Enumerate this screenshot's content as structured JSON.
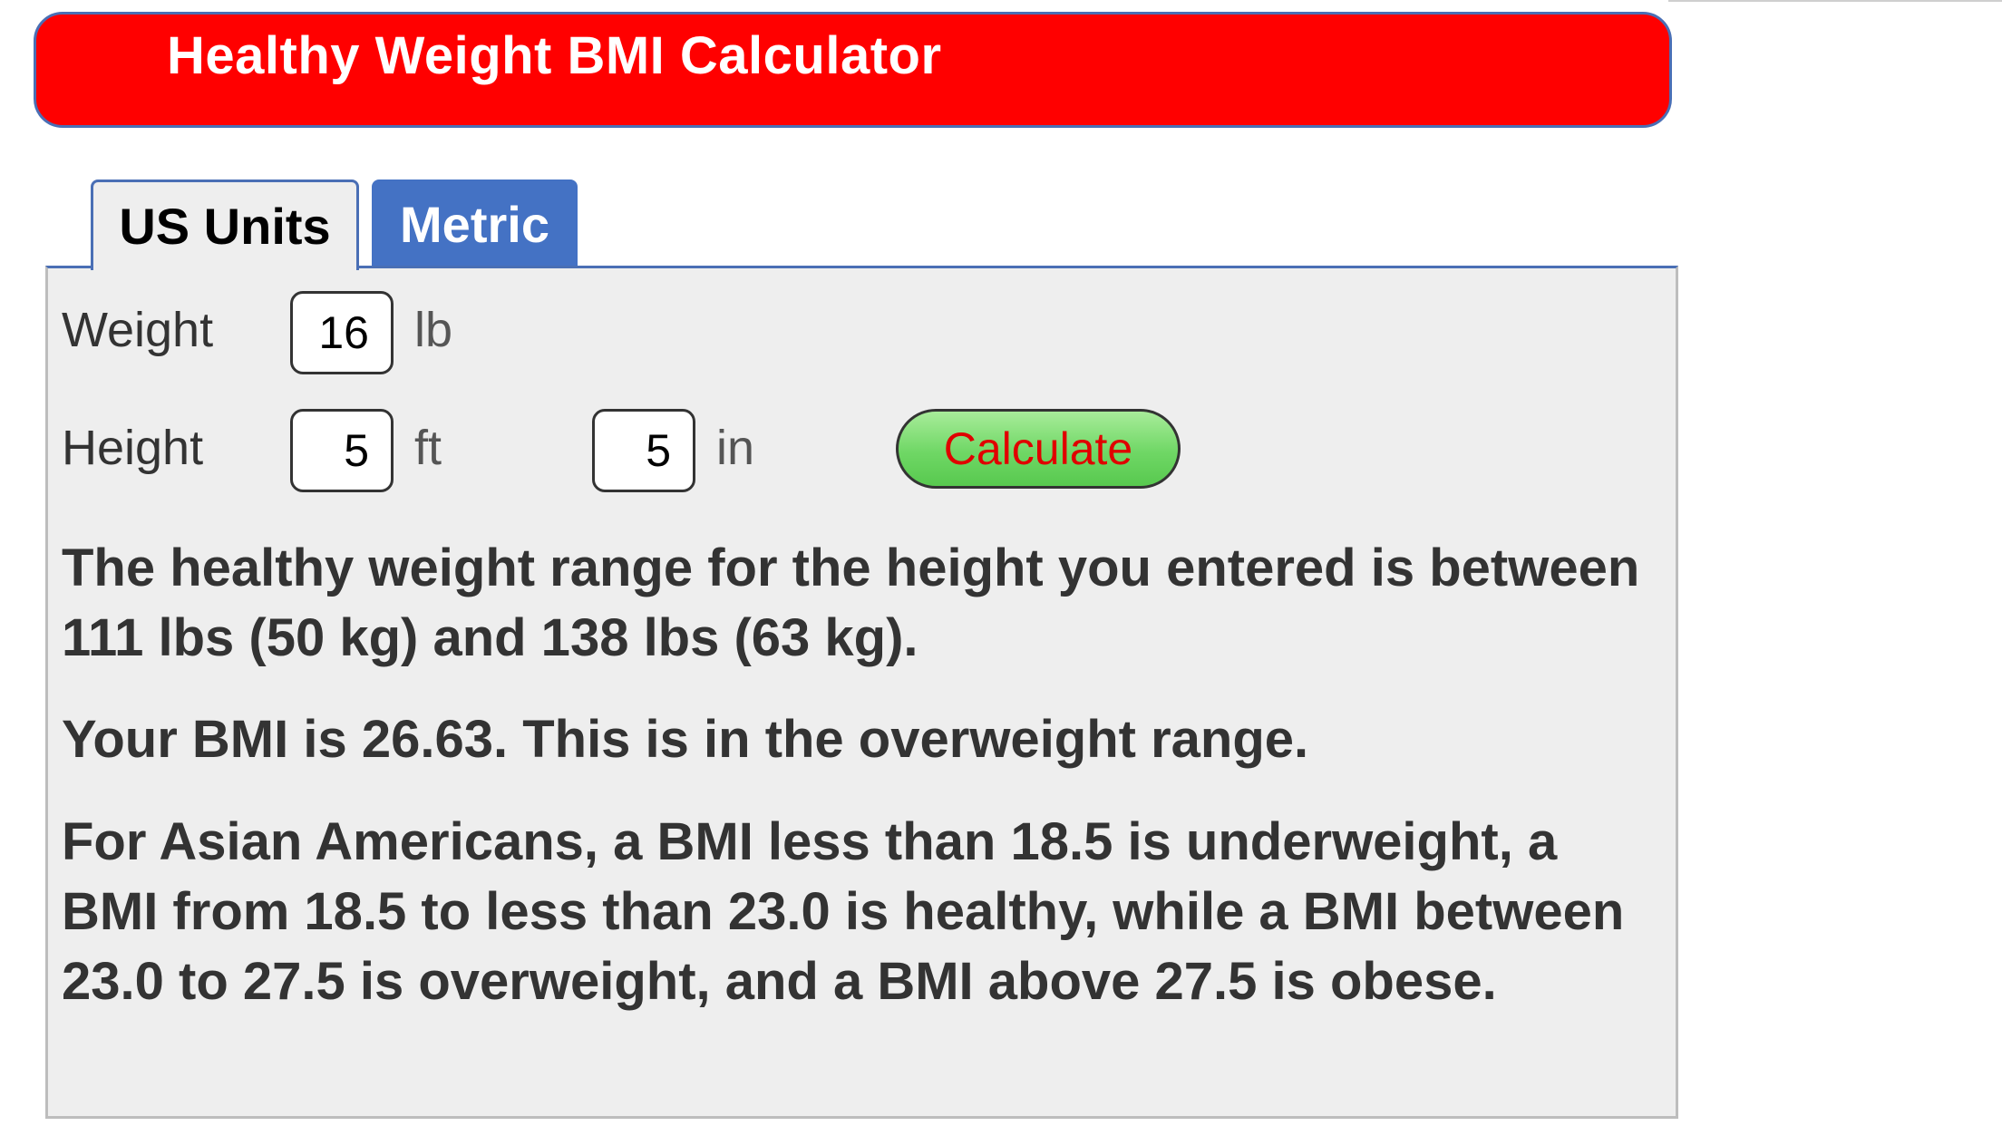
{
  "header": {
    "title": "Healthy Weight BMI Calculator"
  },
  "tabs": [
    {
      "label": "US Units",
      "active": true
    },
    {
      "label": "Metric",
      "active": false
    }
  ],
  "form": {
    "weight": {
      "label": "Weight",
      "value": "16",
      "unit": "lb"
    },
    "height": {
      "label": "Height",
      "feet_value": "5",
      "feet_unit": "ft",
      "inches_value": "5",
      "inches_unit": "in"
    },
    "calculate_label": "Calculate"
  },
  "results": {
    "range_text": "The healthy weight range for the height you entered is between 111 lbs (50 kg) and 138 lbs (63 kg).",
    "bmi_text": "Your BMI is 26.63. This is in the overweight range.",
    "asian_note": "For Asian Americans, a BMI less than 18.5 is underweight, a BMI from 18.5 to less than 23.0 is healthy, while a BMI between 23.0 to 27.5 is overweight, and a BMI above 27.5 is obese."
  },
  "colors": {
    "title_bar": "#ff0000",
    "tab_active_bg": "#eeeeee",
    "tab_inactive_bg": "#4472c4",
    "panel_bg": "#eeeeee",
    "accent_border": "#4a6fb5",
    "button_green": "#6fd765",
    "button_text": "#e00000"
  }
}
